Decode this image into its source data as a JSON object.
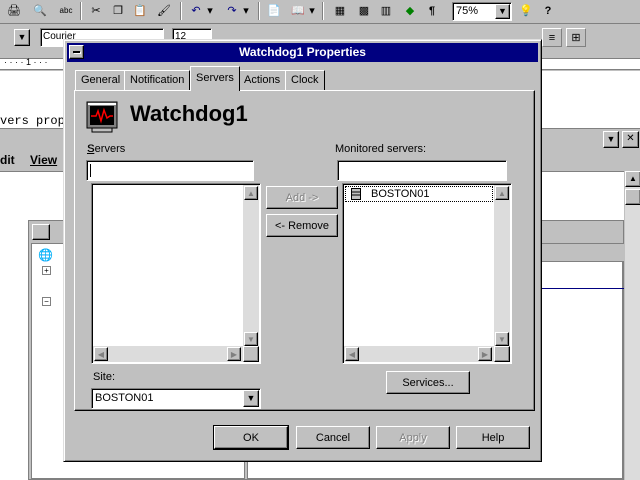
{
  "toolbar": {
    "zoom_value": "75%",
    "font_name": "Courier",
    "font_size": "12",
    "paragraph_mark": "¶",
    "help_icon": "?"
  },
  "background": {
    "text_fragment": "vers prop",
    "menu_edit": "dit",
    "menu_view": "View"
  },
  "dialog": {
    "title": "Watchdog1 Properties",
    "tabs": [
      {
        "label": "General"
      },
      {
        "label": "Notification"
      },
      {
        "label": "Servers"
      },
      {
        "label": "Actions"
      },
      {
        "label": "Clock"
      }
    ],
    "active_tab": "Servers",
    "header_name": "Watchdog1",
    "servers_label": "Servers",
    "servers_filter_value": "",
    "servers_list": [],
    "monitored_label": "Monitored servers:",
    "monitored_filter_value": "",
    "monitored_list": [
      "BOSTON01"
    ],
    "add_button": "Add ->",
    "remove_button": "<- Remove",
    "site_label": "Site:",
    "site_value": "BOSTON01",
    "services_button": "Services...",
    "ok_button": "OK",
    "cancel_button": "Cancel",
    "apply_button": "Apply",
    "help_button": "Help"
  }
}
